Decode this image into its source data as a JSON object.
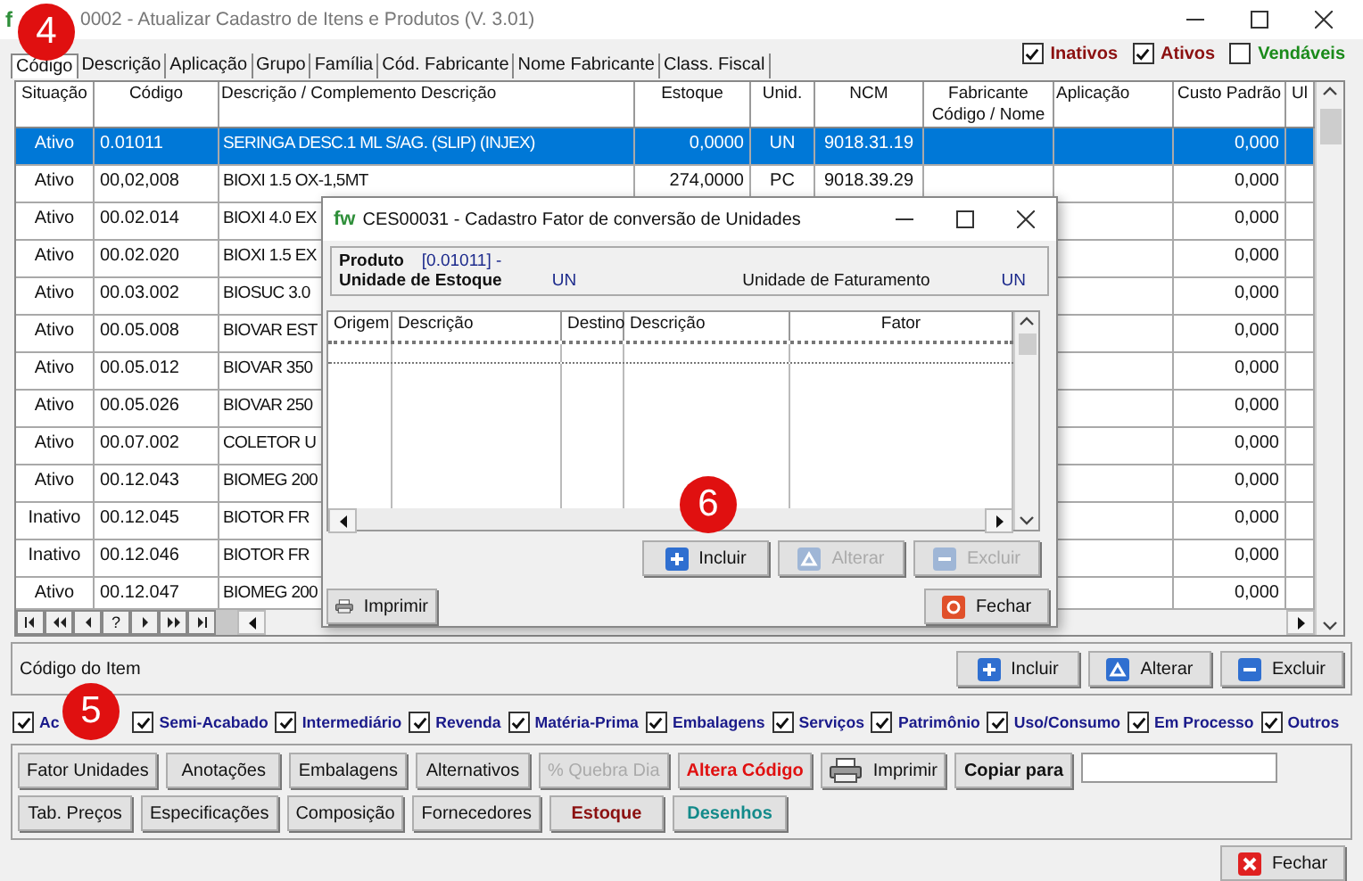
{
  "window": {
    "logo": "f",
    "title": "0002 - Atualizar Cadastro de Itens e Produtos  (V. 3.01)"
  },
  "tabs": [
    {
      "label": "Código",
      "selected": true
    },
    {
      "label": "Descrição",
      "selected": false
    },
    {
      "label": "Aplicação",
      "selected": false
    },
    {
      "label": "Grupo",
      "selected": false
    },
    {
      "label": "Família",
      "selected": false
    },
    {
      "label": "Cód. Fabricante",
      "selected": false
    },
    {
      "label": "Nome Fabricante",
      "selected": false
    },
    {
      "label": "Class. Fiscal",
      "selected": false
    }
  ],
  "status_filters": [
    {
      "label": "Inativos",
      "checked": true,
      "kind": "inactive"
    },
    {
      "label": "Ativos",
      "checked": true,
      "kind": "active"
    },
    {
      "label": "Vendáveis",
      "checked": false,
      "kind": "sellable"
    }
  ],
  "table": {
    "columns": [
      "Situação",
      "Código",
      "Descrição / Complemento Descrição",
      "Estoque",
      "Unid.",
      "NCM",
      "Fabricante Código / Nome",
      "Aplicação",
      "Custo Padrão",
      "Ul"
    ],
    "rows": [
      {
        "status": "Ativo",
        "code": "0.01011",
        "description": "SERINGA DESC.1 ML S/AG. (SLIP) (INJEX)",
        "stock": "0,0000",
        "unit": "UN",
        "ncm": "9018.31.19",
        "cost": "0,000",
        "selected": true
      },
      {
        "status": "Ativo",
        "code": "00,02,008",
        "description": "BIOXI 1.5 OX-1,5MT",
        "stock": "274,0000",
        "unit": "PC",
        "ncm": "9018.39.29",
        "cost": "0,000",
        "selected": false
      },
      {
        "status": "Ativo",
        "code": "00.02.014",
        "description": "BIOXI 4.0 EX",
        "cost": "0,000",
        "selected": false
      },
      {
        "status": "Ativo",
        "code": "00.02.020",
        "description": "BIOXI 1.5 EX",
        "cost": "0,000",
        "selected": false
      },
      {
        "status": "Ativo",
        "code": "00.03.002",
        "description": "BIOSUC 3.0",
        "cost": "0,000",
        "selected": false
      },
      {
        "status": "Ativo",
        "code": "00.05.008",
        "description": "BIOVAR EST",
        "cost": "0,000",
        "selected": false
      },
      {
        "status": "Ativo",
        "code": "00.05.012",
        "description": "BIOVAR 350",
        "cost": "0,000",
        "selected": false
      },
      {
        "status": "Ativo",
        "code": "00.05.026",
        "description": "BIOVAR 250",
        "cost": "0,000",
        "selected": false
      },
      {
        "status": "Ativo",
        "code": "00.07.002",
        "description": "COLETOR U",
        "cost": "0,000",
        "selected": false
      },
      {
        "status": "Ativo",
        "code": "00.12.043",
        "description": "BIOMEG 200",
        "cost": "0,000",
        "selected": false
      },
      {
        "status": "Inativo",
        "code": "00.12.045",
        "description": "BIOTOR FR",
        "cost": "0,000",
        "selected": false
      },
      {
        "status": "Inativo",
        "code": "00.12.046",
        "description": "BIOTOR FR",
        "cost": "0,000",
        "selected": false
      },
      {
        "status": "Ativo",
        "code": "00.12.047",
        "description": "BIOMEG 200",
        "cost": "0,000",
        "selected": false
      }
    ]
  },
  "navigator": [
    {
      "kind": "first"
    },
    {
      "kind": "prior_page"
    },
    {
      "kind": "prior"
    },
    {
      "kind": "refresh",
      "label": "?"
    },
    {
      "kind": "next"
    },
    {
      "kind": "next_page"
    },
    {
      "kind": "last"
    }
  ],
  "item_code_label": "Código do Item",
  "item_actions": [
    {
      "label": "Incluir",
      "kind": "add"
    },
    {
      "label": "Alterar",
      "kind": "edit"
    },
    {
      "label": "Excluir",
      "kind": "delete"
    }
  ],
  "type_filters": [
    {
      "label": "Ac",
      "checked": true
    },
    {
      "label": "Semi-Acabado",
      "checked": true
    },
    {
      "label": "Intermediário",
      "checked": true
    },
    {
      "label": "Revenda",
      "checked": true
    },
    {
      "label": "Matéria-Prima",
      "checked": true
    },
    {
      "label": "Embalagens",
      "checked": true
    },
    {
      "label": "Serviços",
      "checked": true
    },
    {
      "label": "Patrimônio",
      "checked": true
    },
    {
      "label": "Uso/Consumo",
      "checked": true
    },
    {
      "label": "Em Processo",
      "checked": true
    },
    {
      "label": "Outros",
      "checked": true
    }
  ],
  "action_rows": [
    {
      "buttons": [
        {
          "label": "Fator Unidades",
          "kind": "plain",
          "disabled": false
        },
        {
          "label": "Anotações",
          "kind": "plain",
          "disabled": false
        },
        {
          "label": "Embalagens",
          "kind": "plain",
          "disabled": false
        },
        {
          "label": "Alternativos",
          "kind": "plain",
          "disabled": false
        },
        {
          "label": "% Quebra Dia",
          "kind": "plain",
          "disabled": true
        },
        {
          "label": "Altera Código",
          "kind": "alert",
          "disabled": false
        },
        {
          "label": "Imprimir",
          "kind": "print",
          "disabled": false
        },
        {
          "label": "Copiar para",
          "kind": "bold",
          "disabled": false
        },
        {
          "kind": "field"
        }
      ]
    },
    {
      "buttons": [
        {
          "label": "Tab. Preços",
          "kind": "plain",
          "disabled": false
        },
        {
          "label": "Especificações",
          "kind": "plain",
          "disabled": false
        },
        {
          "label": "Composição",
          "kind": "plain",
          "disabled": false
        },
        {
          "label": "Fornecedores",
          "kind": "plain",
          "disabled": false
        },
        {
          "label": "Estoque",
          "kind": "stock",
          "disabled": false
        },
        {
          "label": "Desenhos",
          "kind": "drawings",
          "disabled": false
        }
      ]
    }
  ],
  "close_button": {
    "label": "Fechar"
  },
  "dialog": {
    "logo": "fw",
    "title": "CES00031 - Cadastro Fator de conversão de Unidades",
    "product_label": "Produto",
    "product_value": "[0.01011] -",
    "stock_unit_label": "Unidade de Estoque",
    "stock_unit_value": "UN",
    "billing_unit_label": "Unidade de Faturamento",
    "billing_unit_value": "UN",
    "columns": [
      "Origem",
      "Descrição",
      "Destino",
      "Descrição",
      "Fator"
    ],
    "actions": [
      {
        "label": "Incluir",
        "kind": "add",
        "disabled": false
      },
      {
        "label": "Alterar",
        "kind": "edit",
        "disabled": true
      },
      {
        "label": "Excluir",
        "kind": "delete",
        "disabled": true
      }
    ],
    "print_button": "Imprimir",
    "close_button": "Fechar"
  },
  "callouts": [
    {
      "label": "4"
    },
    {
      "label": "5"
    },
    {
      "label": "6"
    }
  ]
}
